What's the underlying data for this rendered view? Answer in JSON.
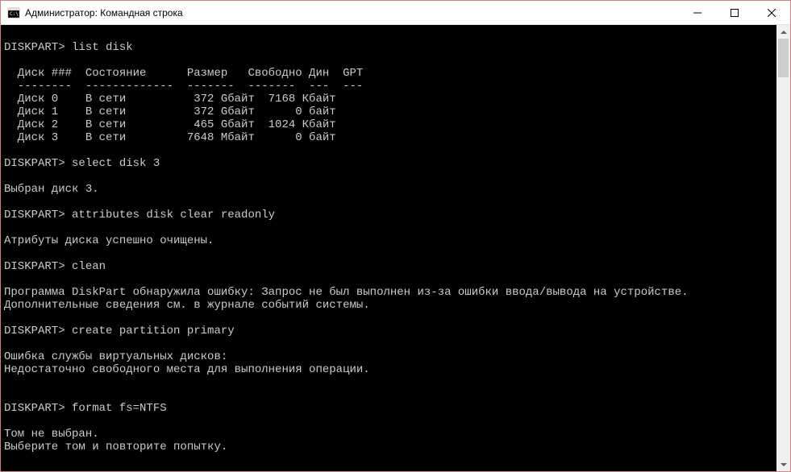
{
  "titlebar": {
    "title": "Администратор: Командная строка"
  },
  "terminal": {
    "lines": [
      "",
      "DISKPART> list disk",
      "",
      "  Диск ###  Состояние      Размер   Свободно Дин  GPT",
      "  --------  -------------  -------  -------  ---  ---",
      "  Диск 0    В сети          372 Gбайт  7168 Кбайт",
      "  Диск 1    В сети          372 Gбайт      0 байт",
      "  Диск 2    В сети          465 Gбайт  1024 Кбайт",
      "  Диск 3    В сети         7648 Mбайт      0 байт",
      "",
      "DISKPART> select disk 3",
      "",
      "Выбран диск 3.",
      "",
      "DISKPART> attributes disk clear readonly",
      "",
      "Атрибуты диска успешно очищены.",
      "",
      "DISKPART> clean",
      "",
      "Программа DiskPart обнаружила ошибку: Запрос не был выполнен из-за ошибки ввода/вывода на устройстве.",
      "Дополнительные сведения см. в журнале событий системы.",
      "",
      "DISKPART> create partition primary",
      "",
      "Ошибка службы виртуальных дисков:",
      "Недостаточно свободного места для выполнения операции.",
      "",
      "",
      "DISKPART> format fs=NTFS",
      "",
      "Том не выбран.",
      "Выберите том и повторите попытку."
    ]
  }
}
